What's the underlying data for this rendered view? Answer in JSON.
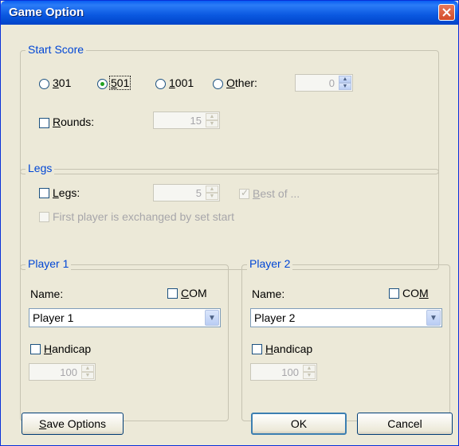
{
  "window": {
    "title": "Game Option"
  },
  "start_score": {
    "legend": "Start Score",
    "options": [
      {
        "label": "301",
        "mnemonic": "3",
        "rest": "01",
        "checked": false
      },
      {
        "label": "501",
        "mnemonic": "5",
        "rest": "01",
        "checked": true
      },
      {
        "label": "1001",
        "mnemonic": "1",
        "rest": "001",
        "checked": false
      },
      {
        "label": "Other:",
        "mnemonic": "O",
        "rest": "ther:",
        "checked": false
      }
    ],
    "other_value": "0",
    "rounds_label_mn": "R",
    "rounds_label_rest": "ounds:",
    "rounds_checked": false,
    "rounds_value": "15"
  },
  "legs": {
    "legend": "Legs",
    "legs_label_mn": "L",
    "legs_label_rest": "egs:",
    "legs_checked": false,
    "legs_value": "5",
    "best_of_mn": "B",
    "best_of_rest": "est of ...",
    "best_of_checked": true,
    "first_player_label": "First player is exchanged by set start",
    "first_player_checked": false
  },
  "player1": {
    "legend": "Player 1",
    "name_label": "Name:",
    "com_mn": "C",
    "com_rest": "OM",
    "com_checked": false,
    "name_value": "Player 1",
    "handicap_mn": "H",
    "handicap_rest": "andicap",
    "handicap_checked": false,
    "handicap_value": "100"
  },
  "player2": {
    "legend": "Player 2",
    "name_label": "Name:",
    "com_pre": "CO",
    "com_mn": "M",
    "com_checked": false,
    "name_value": "Player 2",
    "handicap_mn": "H",
    "handicap_rest": "andicap",
    "handicap_checked": false,
    "handicap_value": "100"
  },
  "buttons": {
    "save_mn": "S",
    "save_rest": "ave Options",
    "ok": "OK",
    "cancel": "Cancel"
  },
  "colors": {
    "title_bar": "#0a58e0",
    "legend_text": "#0046d5",
    "close_button": "#d34b28"
  }
}
